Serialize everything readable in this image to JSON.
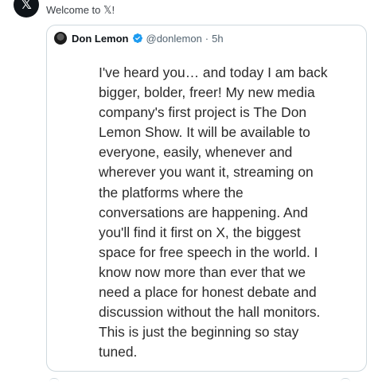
{
  "reply": {
    "avatar_icon": "x-logo-icon",
    "avatar_glyph": "𝕏",
    "text": "Welcome to 𝕏!"
  },
  "quote": {
    "author_name": "Don Lemon",
    "verified_icon": "verified-badge-icon",
    "verified_color": "#1d9bf0",
    "handle": "@donlemon",
    "separator": "·",
    "time": "5h",
    "body": "I've heard you… and today I am back\nbigger, bolder, freer! My new media\ncompany's first project is The Don\nLemon Show.  It will be available to\neveryone, easily, whenever and\nwherever you want it, streaming on\nthe platforms where the\nconversations are happening.  And\nyou'll find it first on X, the biggest\nspace for free speech in the world. I\nknow now more than ever that we\nneed a place for honest debate and\ndiscussion without the hall monitors.\nThis is just the beginning so stay\ntuned."
  }
}
